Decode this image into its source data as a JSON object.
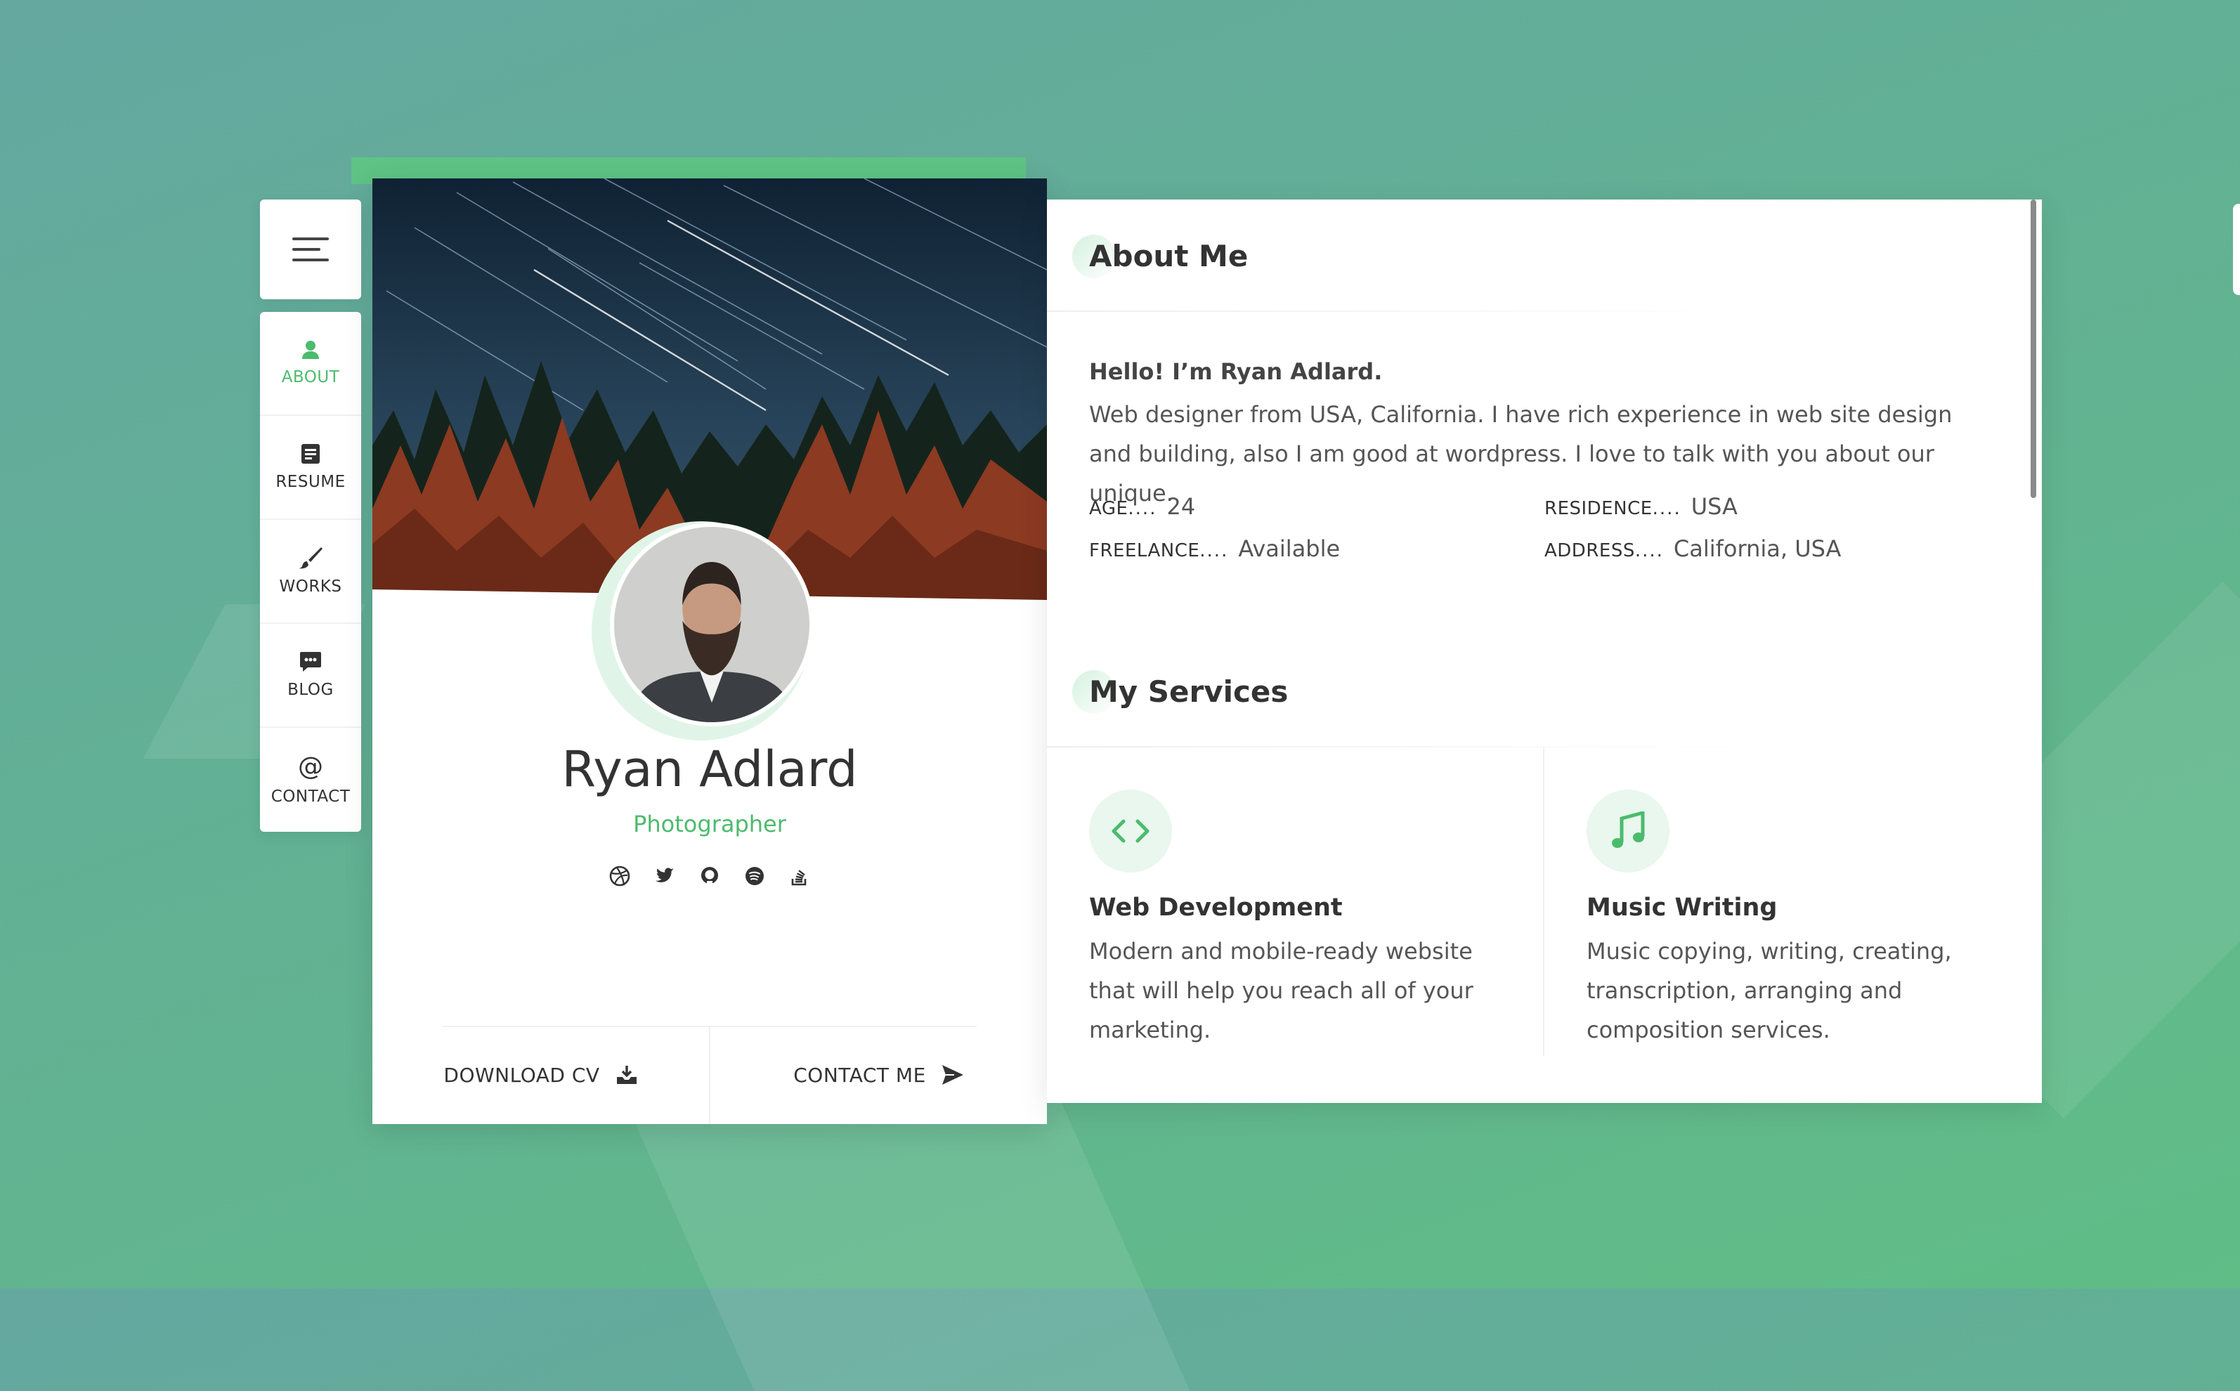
{
  "nav": {
    "items": [
      {
        "label": "ABOUT",
        "icon": "user-icon",
        "active": true
      },
      {
        "label": "RESUME",
        "icon": "document-icon",
        "active": false
      },
      {
        "label": "WORKS",
        "icon": "brush-icon",
        "active": false
      },
      {
        "label": "BLOG",
        "icon": "chat-icon",
        "active": false
      },
      {
        "label": "CONTACT",
        "icon": "at-icon",
        "active": false
      }
    ]
  },
  "profile": {
    "name": "Ryan Adlard",
    "role": "Photographer",
    "socials": [
      "dribbble-icon",
      "twitter-icon",
      "github-icon",
      "spotify-icon",
      "stackoverflow-icon"
    ],
    "download_label": "DOWNLOAD CV",
    "contact_label": "CONTACT ME"
  },
  "about": {
    "title": "About Me",
    "greeting": "Hello! I’m Ryan Adlard.",
    "bio": "Web designer from USA, California. I have rich experience in web site design and building, also I am good at wordpress. I love to talk with you about our unique.",
    "info": {
      "age": {
        "label": "AGE",
        "value": "24"
      },
      "residence": {
        "label": "RESIDENCE",
        "value": "USA"
      },
      "freelance": {
        "label": "FREELANCE",
        "value": "Available"
      },
      "address": {
        "label": "ADDRESS",
        "value": "California, USA"
      }
    },
    "dots": "...."
  },
  "services": {
    "title": "My Services",
    "items": [
      {
        "name": "Web Development",
        "description": "Modern and mobile-ready website that will help you reach all of your marketing.",
        "icon": "code-icon"
      },
      {
        "name": "Music Writing",
        "description": "Music copying, writing, creating, transcription, arranging and composition services.",
        "icon": "music-icon"
      }
    ]
  },
  "colors": {
    "accent": "#4cbb6d",
    "background": "#62b194",
    "text": "#323232"
  }
}
